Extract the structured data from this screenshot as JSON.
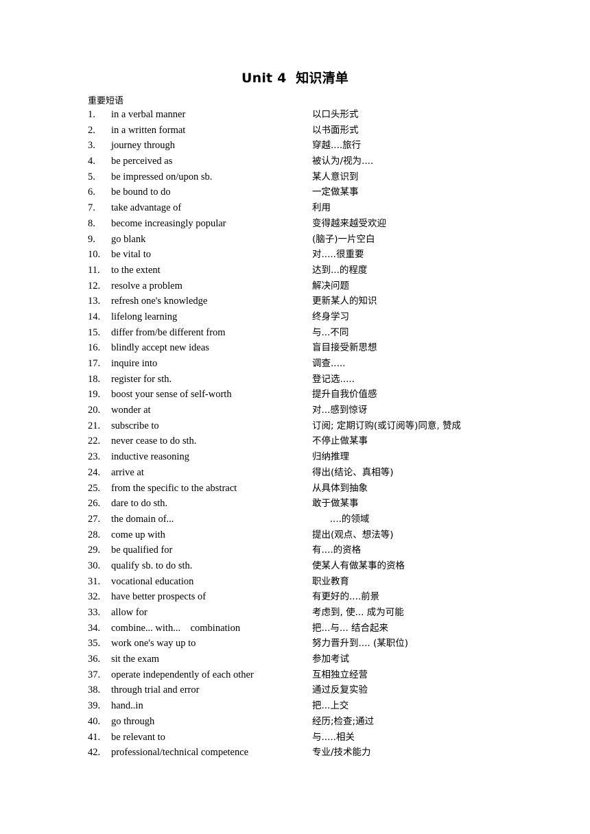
{
  "document": {
    "title": "Unit 4  知识清单",
    "section_heading": "重要短语"
  },
  "phrases": [
    {
      "num": "1.",
      "english": "in a verbal manner",
      "chinese": "以口头形式"
    },
    {
      "num": "2.",
      "english": "in a written format",
      "chinese": "以书面形式"
    },
    {
      "num": "3.",
      "english": "journey through",
      "chinese": "穿越....旅行"
    },
    {
      "num": "4.",
      "english": "be perceived as",
      "chinese": "被认为/视为...."
    },
    {
      "num": "5.",
      "english": "be impressed on/upon sb.",
      "chinese": "某人意识到"
    },
    {
      "num": "6.",
      "english": "be bound to do",
      "chinese": "一定做某事"
    },
    {
      "num": "7.",
      "english": "take advantage of",
      "chinese": "利用"
    },
    {
      "num": "8.",
      "english": "become increasingly popular",
      "chinese": "变得越来越受欢迎"
    },
    {
      "num": "9.",
      "english": "go blank",
      "chinese": "(脑子)一片空白"
    },
    {
      "num": "10.",
      "english": "be vital to",
      "chinese": "对.....很重要"
    },
    {
      "num": "11.",
      "english": "to the extent",
      "chinese": "达到...的程度"
    },
    {
      "num": "12.",
      "english": "resolve a problem",
      "chinese": "解决问题"
    },
    {
      "num": "13.",
      "english": "refresh one's knowledge",
      "chinese": "更新某人的知识"
    },
    {
      "num": "14.",
      "english": "lifelong learning",
      "chinese": "终身学习"
    },
    {
      "num": "15.",
      "english": "differ from/be different from",
      "chinese": "与...不同"
    },
    {
      "num": "16.",
      "english": "blindly accept new ideas",
      "chinese": "盲目接受新思想"
    },
    {
      "num": "17.",
      "english": "inquire into",
      "chinese": "调查....."
    },
    {
      "num": "18.",
      "english": "register for sth.",
      "chinese": "登记选....."
    },
    {
      "num": "19.",
      "english": "boost your sense of self-worth",
      "chinese": "提升自我价值感"
    },
    {
      "num": "20.",
      "english": "wonder at",
      "chinese": "对...感到惊讶"
    },
    {
      "num": "21.",
      "english": "subscribe to",
      "chinese": "订阅; 定期订购(或订阅等)同意, 赞成"
    },
    {
      "num": "22.",
      "english": "never cease to do sth.",
      "chinese": "不停止做某事"
    },
    {
      "num": "23.",
      "english": "inductive reasoning",
      "chinese": "归纳推理"
    },
    {
      "num": "24.",
      "english": "arrive at",
      "chinese": "得出(结论、真相等)"
    },
    {
      "num": "25.",
      "english": "from the specific to the abstract",
      "chinese": "从具体到抽象"
    },
    {
      "num": "26.",
      "english": "dare to do sth.",
      "chinese": "敢于做某事"
    },
    {
      "num": "27.",
      "english": "the domain of...",
      "chinese": "      ....的领域"
    },
    {
      "num": "28.",
      "english": "come up with",
      "chinese": "提出(观点、想法等)"
    },
    {
      "num": "29.",
      "english": "be qualified for",
      "chinese": "有....的资格"
    },
    {
      "num": "30.",
      "english": "qualify sb. to do sth.",
      "chinese": "使某人有做某事的资格"
    },
    {
      "num": "31.",
      "english": "vocational education",
      "chinese": "职业教育"
    },
    {
      "num": "32.",
      "english": "have better prospects of",
      "chinese": "有更好的....前景"
    },
    {
      "num": "33.",
      "english": "allow for",
      "chinese": "考虑到, 使... 成为可能"
    },
    {
      "num": "34.",
      "english": "combine... with...    combination",
      "chinese": "把...与... 结合起来"
    },
    {
      "num": "35.",
      "english": "work one's way up to",
      "chinese": "努力晋升到.... (某职位)"
    },
    {
      "num": "36.",
      "english": "sit the exam",
      "chinese": "参加考试"
    },
    {
      "num": "37.",
      "english": "operate independently of each other",
      "chinese": "互相独立经营"
    },
    {
      "num": "38.",
      "english": "through trial and error",
      "chinese": "通过反复实验"
    },
    {
      "num": "39.",
      "english": "hand..in",
      "chinese": "把...上交"
    },
    {
      "num": "40.",
      "english": "go through",
      "chinese": "经历;检查;通过"
    },
    {
      "num": "41.",
      "english": "be relevant to",
      "chinese": "与.....相关"
    },
    {
      "num": "42.",
      "english": "professional/technical competence",
      "chinese": "专业/技术能力"
    }
  ]
}
